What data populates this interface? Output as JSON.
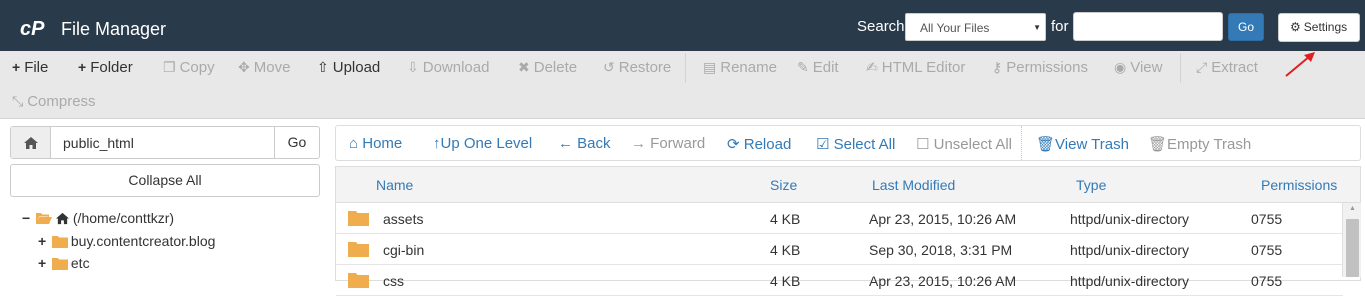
{
  "header": {
    "app_title": "File Manager",
    "search_label": "Search",
    "search_scope": "All Your Files",
    "for_label": "for",
    "search_value": "",
    "go_label": "Go",
    "settings_label": "Settings",
    "background_color": "#293a4a"
  },
  "toolbar": {
    "file": "File",
    "folder": "Folder",
    "copy": "Copy",
    "move": "Move",
    "upload": "Upload",
    "download": "Download",
    "delete": "Delete",
    "restore": "Restore",
    "rename": "Rename",
    "edit": "Edit",
    "html_editor": "HTML Editor",
    "permissions": "Permissions",
    "view": "View",
    "extract": "Extract",
    "compress": "Compress"
  },
  "left_panel": {
    "path_value": "public_html",
    "go_label": "Go",
    "collapse_label": "Collapse All",
    "tree": [
      {
        "label": "(/home/conttkzr)",
        "toggle": "−"
      },
      {
        "label": "buy.contentcreator.blog",
        "toggle": "+"
      },
      {
        "label": "etc",
        "toggle": "+"
      }
    ]
  },
  "nav": {
    "home": "Home",
    "up_one_level": "Up One Level",
    "back": "Back",
    "forward": "Forward",
    "reload": "Reload",
    "select_all": "Select All",
    "unselect_all": "Unselect All",
    "view_trash": "View Trash",
    "empty_trash": "Empty Trash"
  },
  "table": {
    "headers": {
      "name": "Name",
      "size": "Size",
      "modified": "Last Modified",
      "type": "Type",
      "permissions": "Permissions"
    },
    "rows": [
      {
        "name": "assets",
        "size": "4 KB",
        "modified": "Apr 23, 2015, 10:26 AM",
        "type": "httpd/unix-directory",
        "perms": "0755"
      },
      {
        "name": "cgi-bin",
        "size": "4 KB",
        "modified": "Sep 30, 2018, 3:31 PM",
        "type": "httpd/unix-directory",
        "perms": "0755"
      },
      {
        "name": "css",
        "size": "4 KB",
        "modified": "Apr 23, 2015, 10:26 AM",
        "type": "httpd/unix-directory",
        "perms": "0755"
      }
    ]
  },
  "colors": {
    "link": "#337ab7",
    "folder": "#f0ad4e",
    "annotation_arrow": "#e02020"
  }
}
